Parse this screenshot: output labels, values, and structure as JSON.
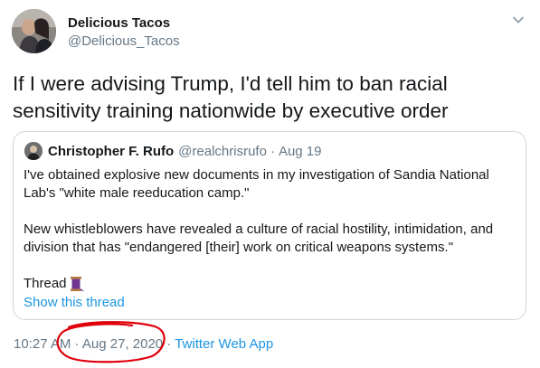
{
  "tweet": {
    "author_name": "Delicious Tacos",
    "author_handle": "@Delicious_Tacos",
    "text": "If I were advising Trump, I'd tell him to ban racial\nsensitivity training nationwide by executive order",
    "more_icon": "chevron-down-icon"
  },
  "quote": {
    "author_name": "Christopher F. Rufo",
    "author_handle": "@realchrisrufo",
    "separator": "·",
    "date": "Aug 19",
    "paragraph1": "I've obtained explosive new documents in my investigation of Sandia National Lab's \"white male reeducation camp.\"",
    "paragraph2": "New whistleblowers have revealed a culture of racial hostility, intimidation, and division that has \"endangered [their] work on critical weapons systems.\"",
    "paragraph3": "Thread",
    "thread_emoji": "spool-of-thread-icon",
    "show_thread": "Show this thread"
  },
  "footer": {
    "time": "10:27 AM",
    "separator1": " · ",
    "date": "Aug 27, 2020",
    "separator2": " · ",
    "source": "Twitter Web App"
  },
  "colors": {
    "link": "#1b95e0",
    "muted": "#657786",
    "border": "#ccd6dd",
    "annotation": "#e0000a"
  }
}
